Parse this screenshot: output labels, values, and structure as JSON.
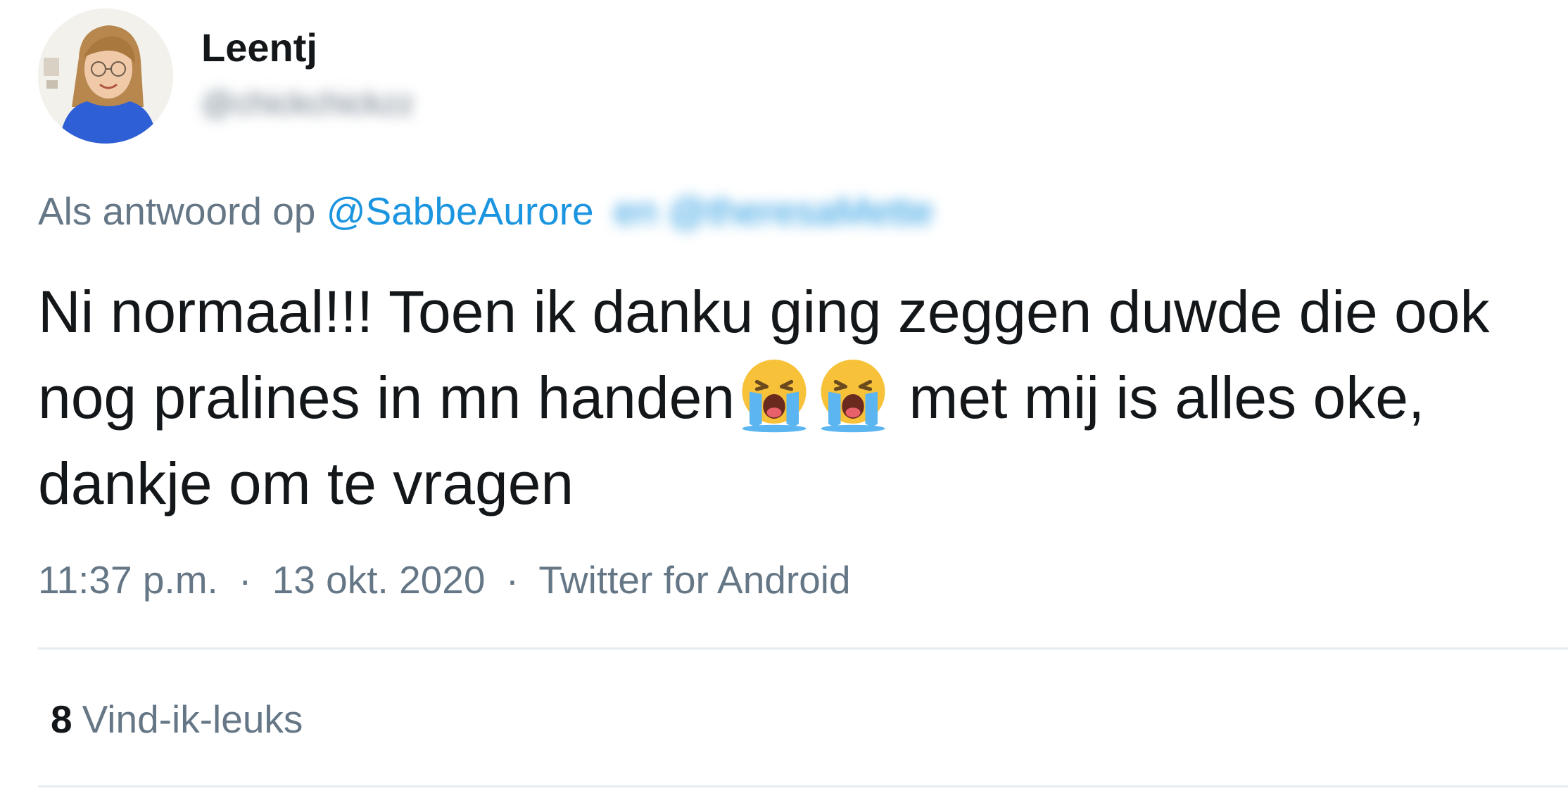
{
  "author": {
    "display_name": "Leentj",
    "handle": "@chickchickzz",
    "avatar_icon": "profile-photo"
  },
  "reply": {
    "prefix": "Als antwoord op",
    "mention": "@SabbeAurore",
    "blurred_more": "en @theresaMette"
  },
  "tweet": {
    "line1": "Ni normaal!!! Toen ik danku ging zeggen duwde die ook",
    "line2_start": "nog pralines in mn handen",
    "line2_end": " met mij is alles oke,",
    "line3": "dankje om te vragen",
    "emoji": "loudly-crying-face"
  },
  "meta": {
    "time": "11:37 p.m.",
    "separator": "·",
    "date": "13 okt. 2020",
    "source": "Twitter for Android"
  },
  "stats": {
    "likes_count": "8",
    "likes_label": "Vind-ik-leuks"
  },
  "colors": {
    "text": "#14171a",
    "secondary": "#657786",
    "link": "#1b95e0",
    "divider": "#e6ecf0"
  }
}
